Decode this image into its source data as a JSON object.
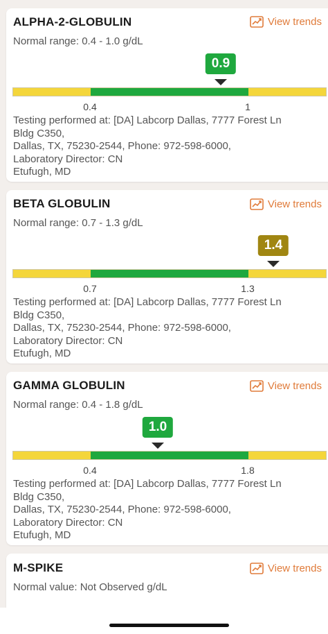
{
  "view_trends_label": "View trends",
  "colors": {
    "accent": "#e07b3a",
    "in_range_green": "#1fa83e",
    "out_range_yellow": "#f4d63b",
    "high_badge": "#a08612"
  },
  "tests": [
    {
      "name": "ALPHA-2-GLOBULIN",
      "range_text": "Normal range: 0.4 - 1.0 g/dL",
      "value": "0.9",
      "status": "normal",
      "low_label": "0.4",
      "high_label": "1",
      "lab_lines": [
        "Testing performed at: [DA] Labcorp Dallas, 7777 Forest Ln",
        "Bldg C350,",
        "Dallas, TX, 75230-2544, Phone: 972-598-6000,",
        "Laboratory Director: CN",
        "Etufugh, MD"
      ]
    },
    {
      "name": "BETA GLOBULIN",
      "range_text": "Normal range: 0.7 - 1.3 g/dL",
      "value": "1.4",
      "status": "high",
      "low_label": "0.7",
      "high_label": "1.3",
      "lab_lines": [
        "Testing performed at: [DA] Labcorp Dallas, 7777 Forest Ln",
        "Bldg C350,",
        "Dallas, TX, 75230-2544, Phone: 972-598-6000,",
        "Laboratory Director: CN",
        "Etufugh, MD"
      ]
    },
    {
      "name": "GAMMA GLOBULIN",
      "range_text": "Normal range: 0.4 - 1.8 g/dL",
      "value": "1.0",
      "status": "normal",
      "low_label": "0.4",
      "high_label": "1.8",
      "lab_lines": [
        "Testing performed at: [DA] Labcorp Dallas, 7777 Forest Ln",
        "Bldg C350,",
        "Dallas, TX, 75230-2544, Phone: 972-598-6000,",
        "Laboratory Director: CN",
        "Etufugh, MD"
      ]
    },
    {
      "name": "M-SPIKE",
      "range_text": "Normal value: Not Observed g/dL"
    }
  ]
}
